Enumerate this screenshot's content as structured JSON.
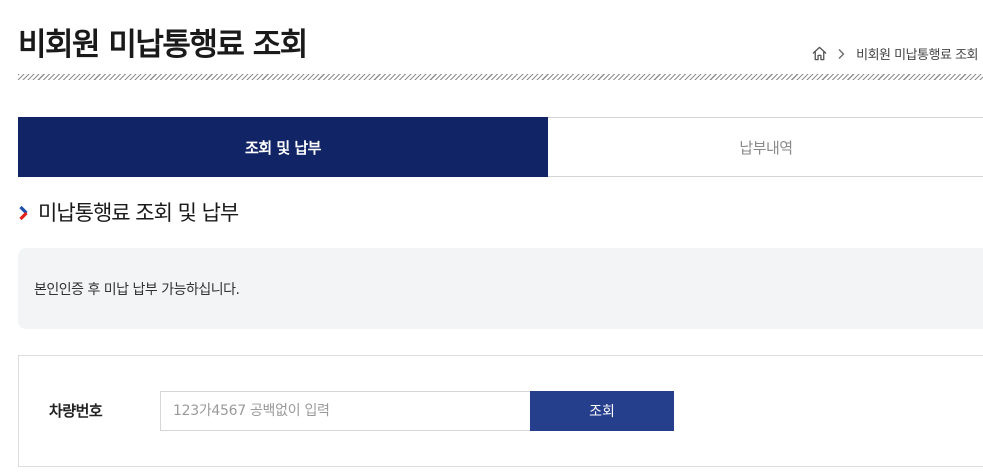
{
  "header": {
    "title": "비회원 미납통행료 조회",
    "breadcrumb": {
      "home_icon": "home-icon",
      "separator_icon": "chevron-right-icon",
      "current": "비회원 미납통행료 조회"
    }
  },
  "tabs": [
    {
      "label": "조회 및 납부",
      "active": true
    },
    {
      "label": "납부내역",
      "active": false
    }
  ],
  "section": {
    "title": "미납통행료 조회 및 납부",
    "marker_icon": "chevron-right-icon",
    "marker_colors": [
      "#1f4fae",
      "#e2231a"
    ]
  },
  "notice": {
    "text": "본인인증 후 미납 납부 가능하십니다."
  },
  "form": {
    "plate_label": "차량번호",
    "plate_value": "",
    "plate_placeholder": "123가4567 공백없이 입력",
    "search_label": "조회"
  },
  "colors": {
    "active_tab": "#112466",
    "button": "#263f8d",
    "notice_bg": "#f3f4f6"
  }
}
